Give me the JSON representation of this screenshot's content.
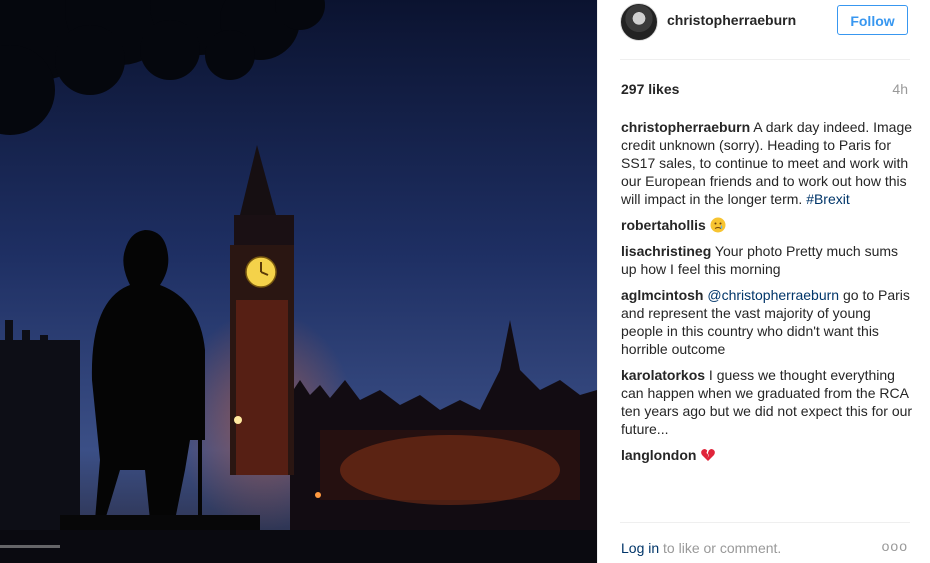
{
  "post": {
    "username": "christopherraeburn",
    "follow_label": "Follow",
    "likes": "297 likes",
    "time": "4h"
  },
  "caption": {
    "user": "christopherraeburn",
    "text": " A dark day indeed. Image credit unknown (sorry). Heading to Paris for SS17 sales, to continue to meet and work with our European friends and to work out how this will impact in the longer term. ",
    "hashtag": "#Brexit"
  },
  "comments": [
    {
      "user": "robertahollis",
      "text": " ",
      "emoji": "crying-face-icon"
    },
    {
      "user": "lisachristineg",
      "text": " Your photo Pretty much sums up how I feel this morning"
    },
    {
      "user": "aglmcintosh",
      "mention": "@christopherraeburn",
      "text": " go to Paris and represent the vast majority of young people in this country who didn't want this horrible outcome"
    },
    {
      "user": "karolatorkos",
      "text": " I guess we thought everything can happen when we graduated from the RCA ten years ago but we did not expect this for our future..."
    },
    {
      "user": "langlondon",
      "text": " ",
      "emoji": "broken-heart-icon"
    }
  ],
  "footer": {
    "login_label": "Log in",
    "rest": " to like or comment.",
    "more": "ooo"
  },
  "colors": {
    "accent": "#3897f0",
    "link": "#003569",
    "muted": "#999999"
  }
}
